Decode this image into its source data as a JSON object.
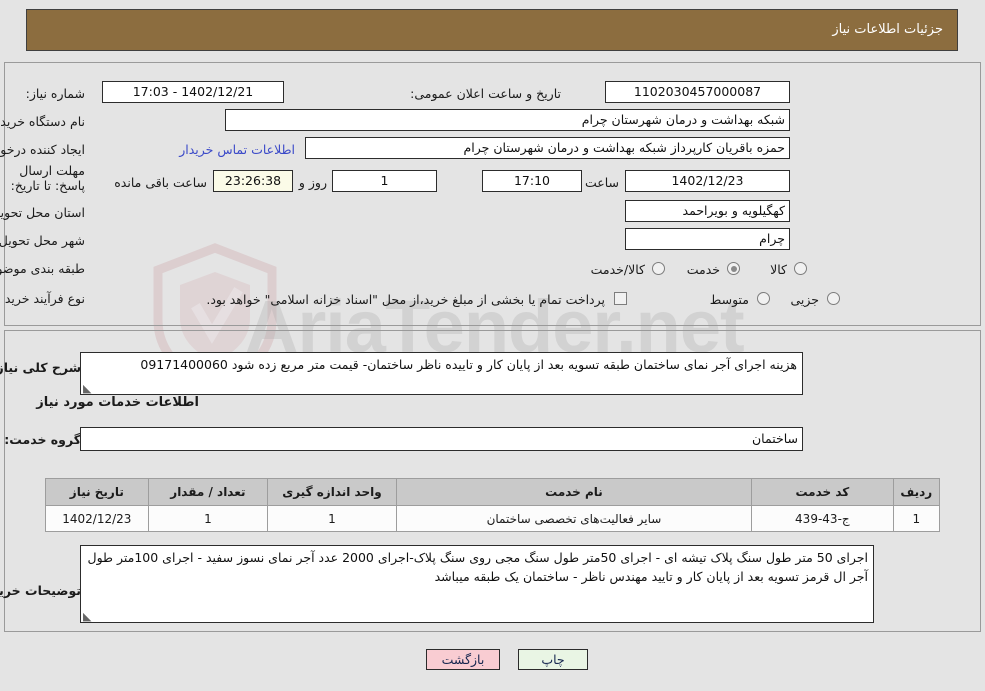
{
  "header": {
    "title": "جزئیات اطلاعات نیاز"
  },
  "watermark": {
    "text": "AriaTender.net",
    "logo_icon": "shield-icon"
  },
  "top_panel": {
    "need_number_label": "شماره نیاز:",
    "need_number_value": "1102030457000087",
    "announce_datetime_label": "تاریخ و ساعت اعلان عمومی:",
    "announce_datetime_value": "1402/12/21 - 17:03",
    "buyer_org_label": "نام دستگاه خریدار:",
    "buyer_org_value": "شبکه بهداشت و درمان شهرستان چرام",
    "requester_label": "ایجاد کننده درخواست:",
    "requester_value": "حمزه باقریان کارپرداز شبکه بهداشت و درمان شهرستان چرام",
    "contact_link": "اطلاعات تماس خریدار",
    "deadline_label": "مهلت ارسال پاسخ: تا تاریخ:",
    "deadline_date": "1402/12/23",
    "hour_label": "ساعت",
    "deadline_time": "17:10",
    "days_value": "1",
    "days_and_label": "روز و",
    "countdown_value": "23:26:38",
    "remaining_label": "ساعت باقی مانده",
    "province_label": "استان محل تحویل:",
    "province_value": "کهگیلویه و بویراحمد",
    "city_label": "شهر محل تحویل:",
    "city_value": "چرام",
    "classification_label": "طبقه بندی موضوعی:",
    "classification_options": [
      {
        "label": "کالا",
        "selected": false
      },
      {
        "label": "خدمت",
        "selected": true
      },
      {
        "label": "کالا/خدمت",
        "selected": false
      }
    ],
    "process_type_label": "نوع فرآیند خرید :",
    "process_type_options": [
      {
        "label": "جزیی",
        "selected": false
      },
      {
        "label": "متوسط",
        "selected": false
      }
    ],
    "treasury_checkbox_checked": false,
    "treasury_note": "پرداخت تمام یا بخشی از مبلغ خرید،از محل \"اسناد خزانه اسلامی\" خواهد بود."
  },
  "mid_panel": {
    "summary_label": "شرح کلی نیاز:",
    "summary_value": "هزینه اجرای آجر نمای ساختمان  طبقه تسویه بعد از پایان کار و تاییده ناظر ساختمان-  قیمت متر مربع زده شود 09171400060",
    "services_heading": "اطلاعات خدمات مورد نیاز",
    "service_group_label": "گروه خدمت:",
    "service_group_value": "ساختمان",
    "table": {
      "columns": [
        "ردیف",
        "کد خدمت",
        "نام خدمت",
        "واحد اندازه گیری",
        "تعداد / مقدار",
        "تاریخ نیاز"
      ],
      "rows": [
        {
          "row_no": "1",
          "service_code": "ج-43-439",
          "service_name": "سایر فعالیت‌های تخصصی ساختمان",
          "unit": "1",
          "quantity": "1",
          "need_date": "1402/12/23"
        }
      ]
    },
    "buyer_notes_label": "توضیحات خریدار:",
    "buyer_notes_value": "اجرای 50 متر طول سنگ پلاک تیشه ای - اجرای 50متر طول سنگ مجی روی سنگ پلاک-اجرای 2000 عدد آجر نمای  نسوز سفید - اجرای 100متر طول آجر ال قرمز تسویه بعد از پایان کار و تایید مهندس ناظر - ساختمان یک طبقه میباشد"
  },
  "footer": {
    "back_button": "بازگشت",
    "print_button": "چاپ"
  },
  "colors": {
    "header_brown": "#8c6d3f",
    "link_blue": "#3a49c8",
    "back_button_pink": "#f9ccd2",
    "print_button_green": "#e9f5e4",
    "countdown_cream": "#fbfbe8",
    "table_header_gray": "#c9c9c9"
  }
}
